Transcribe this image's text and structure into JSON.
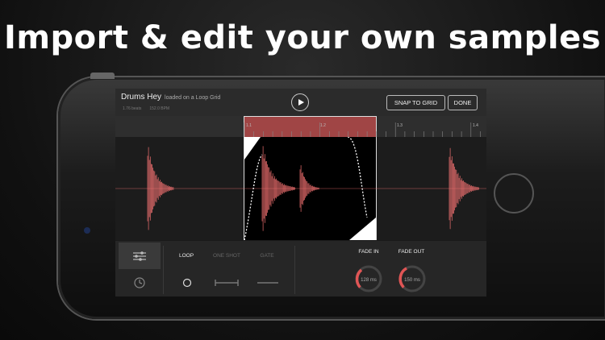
{
  "headline": "Import & edit your own samples",
  "header": {
    "sample_name": "Drums Hey",
    "sample_sub": "loaded on a Loop Grid",
    "beats": "1.76 beats",
    "bpm": "152.0 BPM",
    "snap_label": "SNAP TO GRID",
    "done_label": "DONE"
  },
  "ruler": {
    "ticks": [
      "1.1",
      "1.2",
      "1.3",
      "1.4"
    ]
  },
  "modes": {
    "loop": "LOOP",
    "one_shot": "ONE SHOT",
    "gate": "GATE",
    "selected": "LOOP"
  },
  "fades": {
    "fade_in_label": "FADE IN",
    "fade_in_value": "128 ms",
    "fade_out_label": "FADE OUT",
    "fade_out_value": "150 ms"
  },
  "colors": {
    "accent": "#e05555",
    "region": "#a04545",
    "waveform": "#f07070"
  }
}
